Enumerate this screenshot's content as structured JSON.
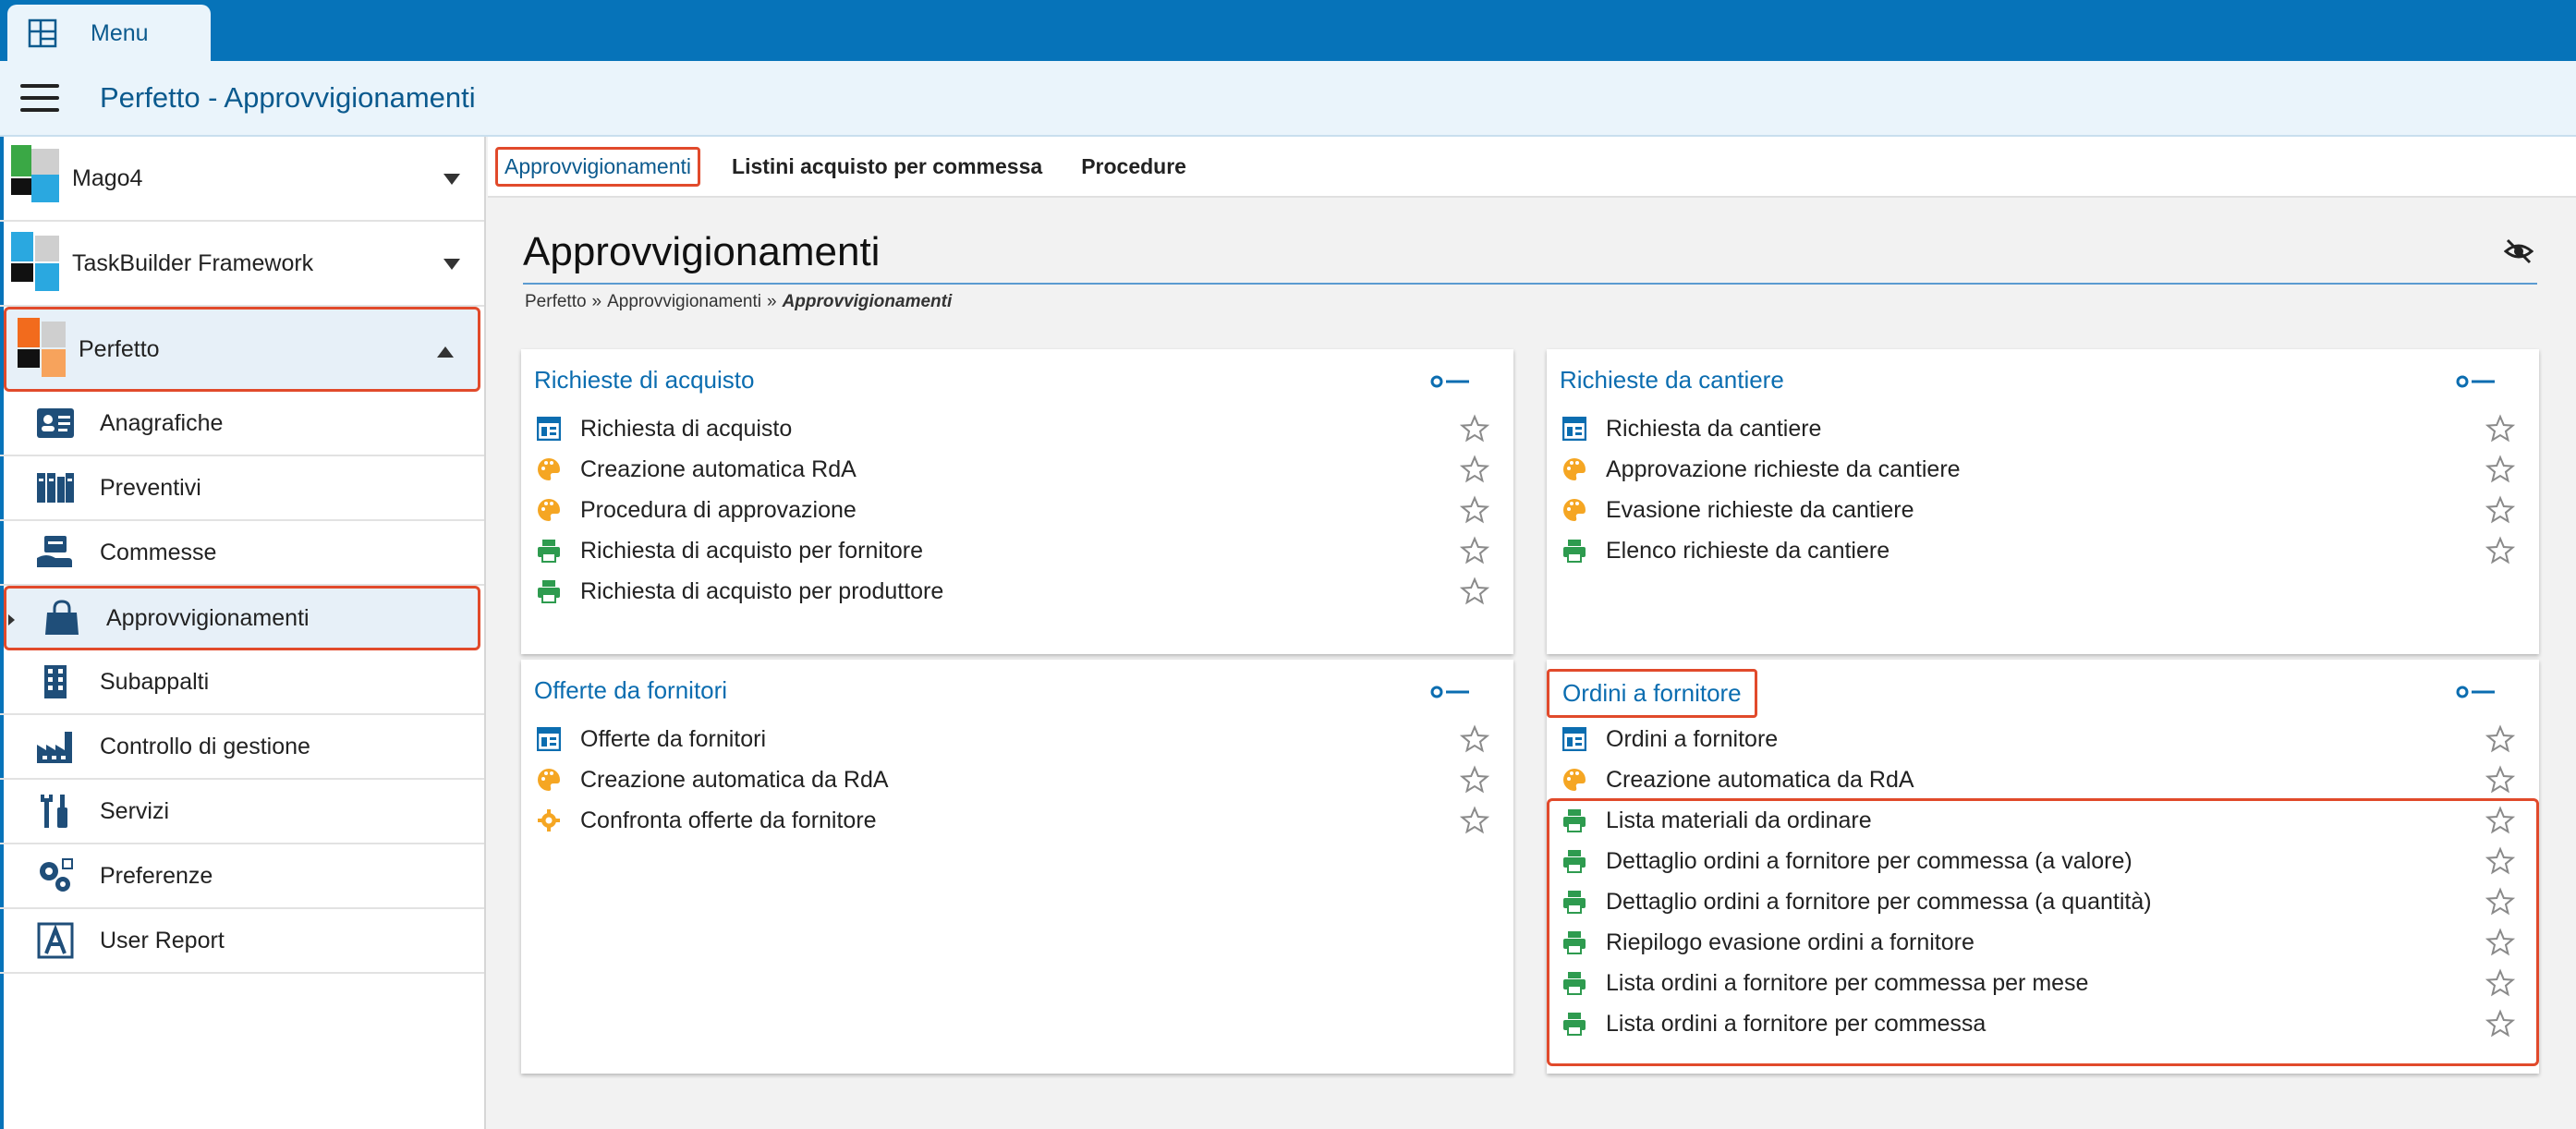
{
  "topbar": {
    "menu_label": "Menu"
  },
  "header": {
    "title": "Perfetto - Approvvigionamenti"
  },
  "sidebar": {
    "modules": [
      {
        "label": "Mago4"
      },
      {
        "label": "TaskBuilder Framework"
      },
      {
        "label": "Perfetto"
      }
    ],
    "subitems": [
      {
        "label": "Anagrafiche",
        "icon": "contact-card-icon"
      },
      {
        "label": "Preventivi",
        "icon": "books-icon"
      },
      {
        "label": "Commesse",
        "icon": "hand-box-icon"
      },
      {
        "label": "Approvvigionamenti",
        "icon": "shopping-bag-icon"
      },
      {
        "label": "Subappalti",
        "icon": "building-icon"
      },
      {
        "label": "Controllo di gestione",
        "icon": "factory-icon"
      },
      {
        "label": "Servizi",
        "icon": "tools-icon"
      },
      {
        "label": "Preferenze",
        "icon": "gears-icon"
      },
      {
        "label": "User Report",
        "icon": "report-icon"
      }
    ]
  },
  "tabs": [
    "Approvvigionamenti",
    "Listini acquisto per commessa",
    "Procedure"
  ],
  "page": {
    "title": "Approvvigionamenti",
    "breadcrumb": [
      "Perfetto",
      "Approvvigionamenti",
      "Approvvigionamenti"
    ]
  },
  "cards": [
    {
      "title": "Richieste di acquisto",
      "items": [
        {
          "label": "Richiesta di acquisto",
          "icon": "document-icon"
        },
        {
          "label": "Creazione automatica RdA",
          "icon": "palette-icon"
        },
        {
          "label": "Procedura di approvazione",
          "icon": "palette-icon"
        },
        {
          "label": "Richiesta di acquisto per fornitore",
          "icon": "printer-icon"
        },
        {
          "label": "Richiesta di acquisto per produttore",
          "icon": "printer-icon"
        }
      ]
    },
    {
      "title": "Richieste da cantiere",
      "items": [
        {
          "label": "Richiesta da cantiere",
          "icon": "document-icon"
        },
        {
          "label": "Approvazione richieste da cantiere",
          "icon": "palette-icon"
        },
        {
          "label": "Evasione richieste da cantiere",
          "icon": "palette-icon"
        },
        {
          "label": "Elenco richieste da cantiere",
          "icon": "printer-icon"
        }
      ]
    },
    {
      "title": "Offerte da fornitori",
      "items": [
        {
          "label": "Offerte da fornitori",
          "icon": "document-icon"
        },
        {
          "label": "Creazione automatica da RdA",
          "icon": "palette-icon"
        },
        {
          "label": "Confronta offerte da fornitore",
          "icon": "gear-icon"
        }
      ]
    },
    {
      "title": "Ordini a fornitore",
      "items": [
        {
          "label": "Ordini a fornitore",
          "icon": "document-icon"
        },
        {
          "label": "Creazione automatica da RdA",
          "icon": "palette-icon"
        },
        {
          "label": "Lista materiali da ordinare",
          "icon": "printer-icon"
        },
        {
          "label": "Dettaglio ordini a fornitore per commessa (a valore)",
          "icon": "printer-icon"
        },
        {
          "label": "Dettaglio ordini a fornitore per commessa (a quantità)",
          "icon": "printer-icon"
        },
        {
          "label": "Riepilogo evasione ordini a fornitore",
          "icon": "printer-icon"
        },
        {
          "label": "Lista ordini a fornitore per commessa per mese",
          "icon": "printer-icon"
        },
        {
          "label": "Lista ordini a fornitore per commessa",
          "icon": "printer-icon"
        }
      ]
    }
  ],
  "colors": {
    "topbar": "#0673b9",
    "accent": "#0b6db0",
    "highlight": "#e14a2b",
    "printer": "#2e9b4f",
    "palette": "#f5a623"
  }
}
